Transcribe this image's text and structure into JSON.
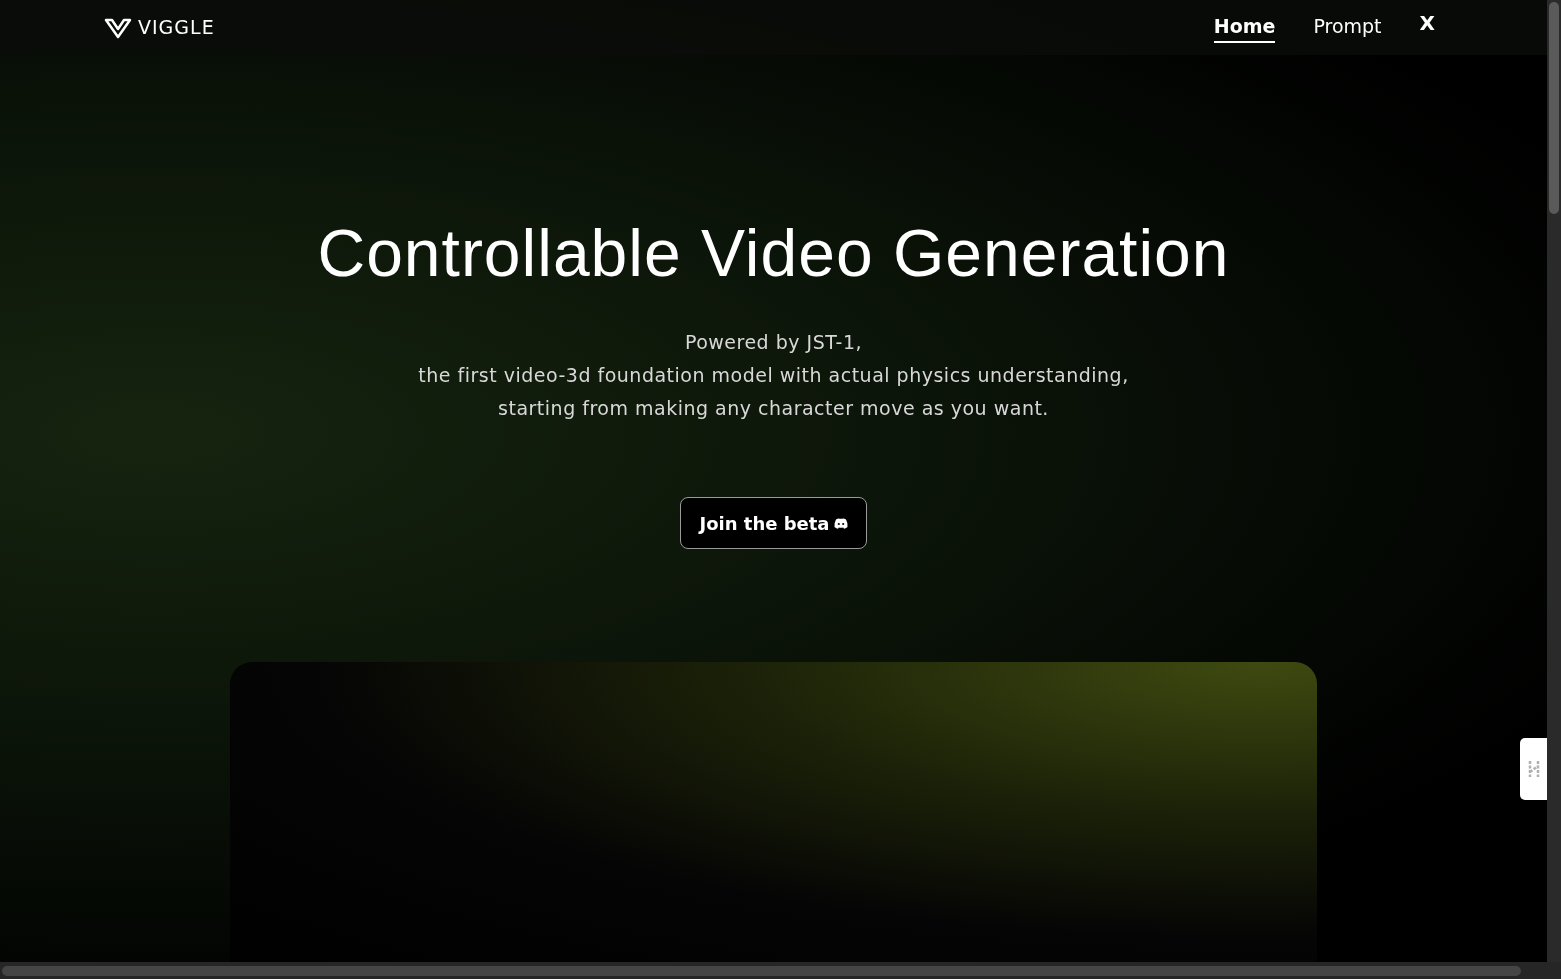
{
  "header": {
    "logo_text": "VIGGLE",
    "nav": [
      {
        "label": "Home",
        "selected": true
      },
      {
        "label": "Prompt",
        "selected": false
      },
      {
        "label": "X",
        "selected": false
      }
    ]
  },
  "hero": {
    "title": "Controllable Video Generation",
    "subtitle_lines": [
      "Powered by JST-1,",
      "the first video-3d foundation model with actual physics understanding,",
      "starting from making any character move as you want."
    ],
    "button": "Join the beta"
  }
}
